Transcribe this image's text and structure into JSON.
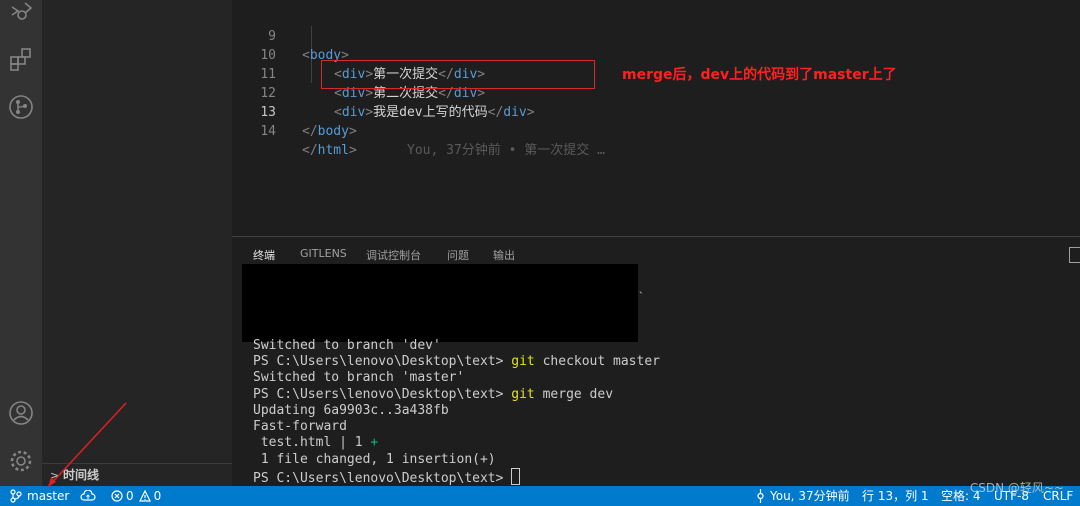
{
  "editor": {
    "lines": [
      {
        "num": "9"
      },
      {
        "num": "10"
      },
      {
        "num": "11"
      },
      {
        "num": "12"
      },
      {
        "num": "13"
      },
      {
        "num": "14"
      }
    ],
    "code": {
      "body_open": "body",
      "div": "div",
      "line10_text": "第一次提交",
      "line11_text": "第二次提交",
      "line12_text": "我是dev上写的代码",
      "body_close": "body",
      "html_close": "html"
    },
    "blame": "You, 37分钟前 • 第一次提交 …"
  },
  "annotation": "merge后，dev上的代码到了master上了",
  "sidebar": {
    "timeline_label": "时间线"
  },
  "panel": {
    "tabs": [
      {
        "label": "终端"
      },
      {
        "label": "GITLENS"
      },
      {
        "label": "调试控制台"
      },
      {
        "label": "问题"
      },
      {
        "label": "输出"
      }
    ],
    "blackout_mark": "`",
    "terminal": {
      "l1": "Switched to branch 'dev'",
      "prompt": "PS C:\\Users\\lenovo\\Desktop\\text> ",
      "git": "git",
      "cmd_checkout": " checkout master",
      "l3": "Switched to branch 'master'",
      "cmd_merge": " merge dev",
      "l5": "Updating 6a9903c..3a438fb",
      "l6": "Fast-forward",
      "l7a": " test.html | 1 ",
      "l7b": "+",
      "l8": " 1 file changed, 1 insertion(+)"
    }
  },
  "status": {
    "branch": "master",
    "errors": "0",
    "warnings": "0",
    "blame": "You, 37分钟前",
    "position": "行 13，列 1",
    "spaces": "空格: 4",
    "encoding": "UTF-8",
    "eol": "CRLF"
  },
  "watermark": "CSDN @轻风~~",
  "colors": {
    "statusbar": "#007acc",
    "activitybar": "#333333",
    "annotation": "#ff2020"
  }
}
